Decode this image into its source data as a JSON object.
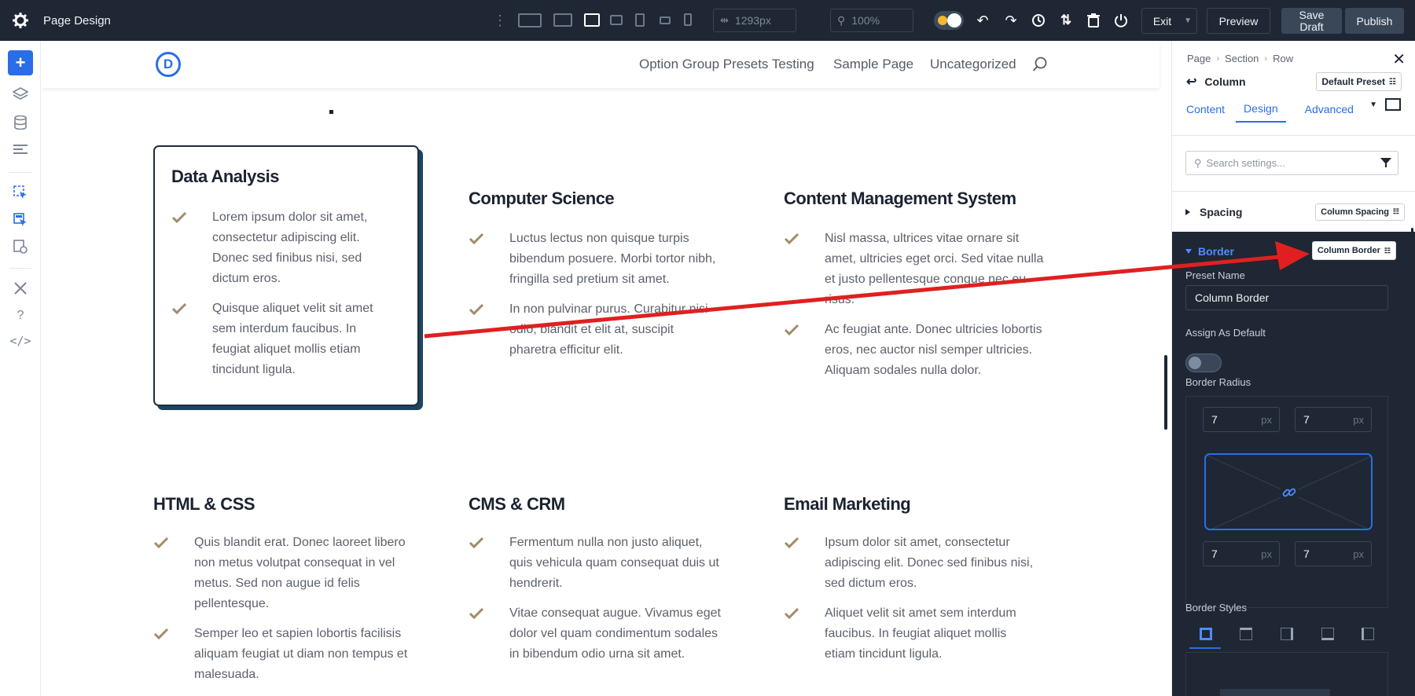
{
  "topbar": {
    "title": "Page Design",
    "width_value": "1293px",
    "zoom_value": "100%",
    "exit_label": "Exit",
    "preview_label": "Preview",
    "save_draft_line1": "Save",
    "save_draft_line2": "Draft",
    "publish_label": "Publish"
  },
  "site": {
    "logo_letter": "D",
    "nav": [
      "Option Group Presets Testing",
      "Sample Page",
      "Uncategorized"
    ],
    "heading_fragment": "."
  },
  "cards": [
    {
      "title": "Data Analysis",
      "items": [
        [
          "Lorem ipsum dolor sit amet,",
          "consectetur adipiscing elit.",
          "Donec sed finibus nisi, sed",
          "dictum eros."
        ],
        [
          "Quisque aliquet velit sit amet",
          "sem interdum faucibus. In",
          "feugiat aliquet mollis etiam",
          "tincidunt ligula."
        ]
      ]
    },
    {
      "title": "Computer Science",
      "items": [
        [
          "Luctus lectus non quisque turpis",
          "bibendum posuere. Morbi tortor nibh,",
          "fringilla sed pretium sit amet."
        ],
        [
          "In non pulvinar purus. Curabitur nisi",
          "odio, blandit et elit at, suscipit",
          "pharetra efficitur elit."
        ]
      ]
    },
    {
      "title": "Content Management System",
      "items": [
        [
          "Nisl massa, ultrices vitae ornare sit",
          "amet, ultricies eget orci. Sed vitae nulla",
          "et justo pellentesque congue nec eu",
          "risus."
        ],
        [
          "Ac feugiat ante. Donec ultricies lobortis",
          "eros, nec auctor nisl semper ultricies.",
          "Aliquam sodales nulla dolor."
        ]
      ]
    },
    {
      "title": "HTML & CSS",
      "items": [
        [
          "Quis blandit erat. Donec laoreet libero",
          "non metus volutpat consequat in vel",
          "metus. Sed non augue id felis",
          "pellentesque."
        ],
        [
          "Semper leo et sapien lobortis facilisis",
          "aliquam feugiat ut diam non tempus et",
          "malesuada."
        ]
      ]
    },
    {
      "title": "CMS & CRM",
      "items": [
        [
          "Fermentum nulla non justo aliquet,",
          "quis vehicula quam consequat duis ut",
          "hendrerit."
        ],
        [
          "Vitae consequat augue. Vivamus eget",
          "dolor vel quam condimentum sodales",
          "in bibendum odio urna sit amet."
        ]
      ]
    },
    {
      "title": "Email Marketing",
      "items": [
        [
          "Ipsum dolor sit amet, consectetur",
          "adipiscing elit. Donec sed finibus nisi,",
          "sed dictum eros."
        ],
        [
          "Aliquet velit sit amet sem interdum",
          "faucibus. In feugiat aliquet mollis",
          "etiam tincidunt ligula."
        ]
      ]
    }
  ],
  "panel": {
    "breadcrumb": [
      "Page",
      "Section",
      "Row"
    ],
    "module_name": "Column",
    "preset_label": "Default Preset",
    "tabs": [
      "Content",
      "Design",
      "Advanced"
    ],
    "active_tab": "Design",
    "search_placeholder": "Search settings...",
    "spacing_label": "Spacing",
    "spacing_preset": "Column Spacing",
    "border_label": "Border",
    "border_preset": "Column Border",
    "preset_name_label": "Preset Name",
    "preset_name_value": "Column Border",
    "assign_default_label": "Assign As Default",
    "assign_default_on": false,
    "border_radius_label": "Border Radius",
    "radius": {
      "top_left": "7",
      "top_right": "7",
      "bottom_left": "7",
      "bottom_right": "7",
      "unit": "px"
    },
    "border_styles_label": "Border Styles"
  },
  "colors": {
    "accent": "#2b6de8",
    "topbar_bg": "#1e2733",
    "check": "#a08c6a",
    "annotation_arrow": "#e02020"
  }
}
